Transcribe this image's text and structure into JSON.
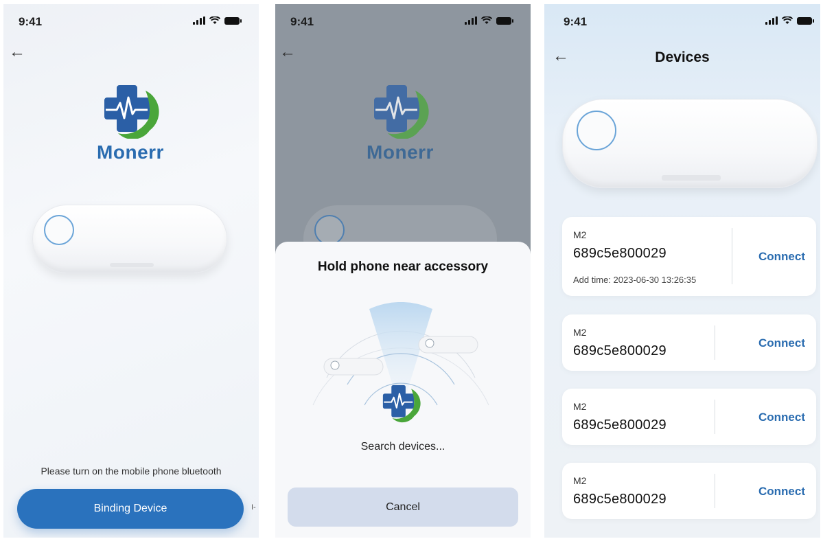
{
  "status": {
    "time": "9:41"
  },
  "brand": {
    "name": "Monerr"
  },
  "screen1": {
    "hint": "Please turn on the mobile phone bluetooth",
    "primary_button": "Binding Device",
    "side_fragment": "I-"
  },
  "screen2": {
    "sheet_title": "Hold phone near accessory",
    "searching": "Search devices...",
    "cancel": "Cancel"
  },
  "screen3": {
    "title": "Devices",
    "devices": [
      {
        "model": "M2",
        "id": "689c5e800029",
        "add_time": "Add time: 2023-06-30 13:26:35",
        "action": "Connect"
      },
      {
        "model": "M2",
        "id": "689c5e800029",
        "add_time": "",
        "action": "Connect"
      },
      {
        "model": "M2",
        "id": "689c5e800029",
        "add_time": "",
        "action": "Connect"
      },
      {
        "model": "M2",
        "id": "689c5e800029",
        "add_time": "",
        "action": "Connect"
      }
    ]
  },
  "icons": {
    "back": "arrow-left-icon",
    "signal": "signal-icon",
    "wifi": "wifi-icon",
    "battery": "battery-icon",
    "logo": "medical-cross-heartbeat-icon"
  },
  "colors": {
    "accent": "#2a72bd",
    "brand_text": "#2a6cb0",
    "cancel_bg": "#d3dcec",
    "logo_green": "#4aa63a"
  }
}
